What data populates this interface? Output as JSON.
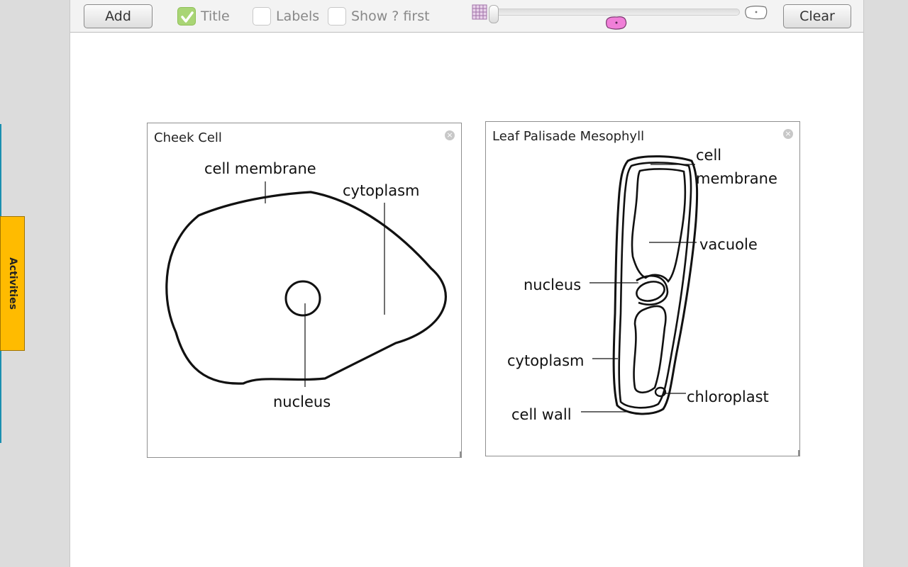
{
  "sidebar": {
    "activities_label": "Activities"
  },
  "toolbar": {
    "add_label": "Add",
    "clear_label": "Clear",
    "options": [
      {
        "label": "Title",
        "checked": true
      },
      {
        "label": "Labels",
        "checked": false
      },
      {
        "label": "Show ? first",
        "checked": false
      }
    ],
    "zoom_slider": {
      "value": 0,
      "left_icon": "plant-cell-grid-icon",
      "right_icon": "animal-cell-outline-icon",
      "marker_icon": "pink-cell-icon"
    }
  },
  "cards": [
    {
      "title": "Cheek Cell",
      "labels": {
        "cell_membrane": "cell membrane",
        "cytoplasm": "cytoplasm",
        "nucleus": "nucleus"
      }
    },
    {
      "title": "Leaf Palisade Mesophyll",
      "labels": {
        "cell_membrane_1": "cell",
        "cell_membrane_2": "membrane",
        "vacuole": "vacuole",
        "nucleus": "nucleus",
        "cytoplasm": "cytoplasm",
        "chloroplast": "chloroplast",
        "cell_wall": "cell wall"
      }
    }
  ],
  "colors": {
    "activities_tab": "#ffbb00",
    "checked_box": "#a9d575",
    "cell_marker": "#f07fd8",
    "sidebar_line": "#1a8fb0"
  }
}
